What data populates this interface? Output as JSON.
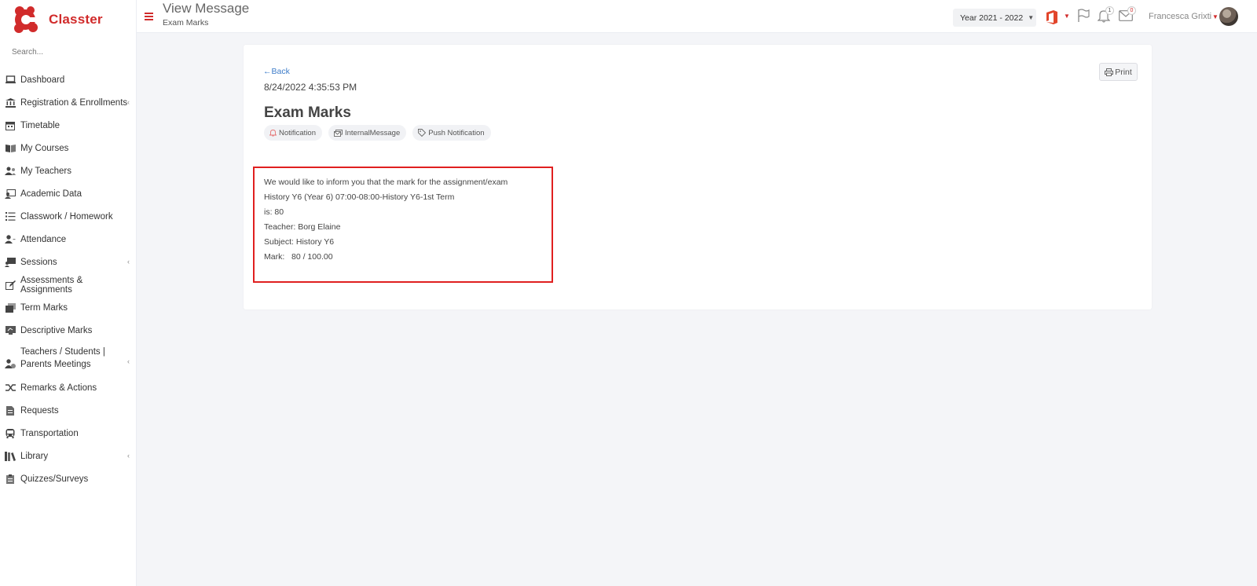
{
  "app": {
    "brand_name": "Classter",
    "brand_color": "#d12b2b"
  },
  "sidebar": {
    "search_placeholder": "Search...",
    "items": [
      {
        "label": "Dashboard",
        "icon": "laptop-icon",
        "has_arrow": false
      },
      {
        "label": "Registration & Enrollments",
        "icon": "institution-icon",
        "has_arrow": true
      },
      {
        "label": "Timetable",
        "icon": "calendar-icon",
        "has_arrow": false
      },
      {
        "label": "My Courses",
        "icon": "book-open-icon",
        "has_arrow": false
      },
      {
        "label": "My Teachers",
        "icon": "users-icon",
        "has_arrow": false
      },
      {
        "label": "Academic Data",
        "icon": "id-card-icon",
        "has_arrow": false
      },
      {
        "label": "Classwork / Homework",
        "icon": "list-icon",
        "has_arrow": false
      },
      {
        "label": "Attendance",
        "icon": "user-check-icon",
        "has_arrow": false
      },
      {
        "label": "Sessions",
        "icon": "presentation-icon",
        "has_arrow": true
      },
      {
        "label": "Assessments & Assignments",
        "icon": "edit-icon",
        "has_arrow": false
      },
      {
        "label": "Term Marks",
        "icon": "stack-icon",
        "has_arrow": false
      },
      {
        "label": "Descriptive Marks",
        "icon": "chalkboard-icon",
        "has_arrow": false
      },
      {
        "label": "Teachers / Students | Parents Meetings",
        "icon": "user-clock-icon",
        "has_arrow": true
      },
      {
        "label": "Remarks & Actions",
        "icon": "random-icon",
        "has_arrow": false
      },
      {
        "label": "Requests",
        "icon": "file-icon",
        "has_arrow": false
      },
      {
        "label": "Transportation",
        "icon": "bus-icon",
        "has_arrow": false
      },
      {
        "label": "Library",
        "icon": "books-icon",
        "has_arrow": true
      },
      {
        "label": "Quizzes/Surveys",
        "icon": "clipboard-icon",
        "has_arrow": false
      }
    ]
  },
  "header": {
    "title": "View Message",
    "subtitle": "Exam Marks",
    "year_select": "Year 2021 - 2022",
    "notifications_count": "1",
    "messages_count": "0",
    "user_name": "Francesca Grixti"
  },
  "message": {
    "back_label": "Back",
    "timestamp": "8/24/2022 4:35:53 PM",
    "print_label": "Print",
    "title": "Exam Marks",
    "tags": [
      {
        "label": "Notification",
        "icon": "bell-icon"
      },
      {
        "label": "InternalMessage",
        "icon": "envelopes-icon"
      },
      {
        "label": "Push Notification",
        "icon": "tag-icon"
      }
    ],
    "body_lines": [
      "We would like to inform you that the mark for the assignment/exam",
      "History Y6 (Year 6) 07:00-08:00-History Y6-1st Term",
      "is: 80",
      "Teacher: Borg Elaine",
      "Subject: History Y6",
      "Mark:   80 / 100.00"
    ],
    "highlight_color": "#e02020"
  }
}
